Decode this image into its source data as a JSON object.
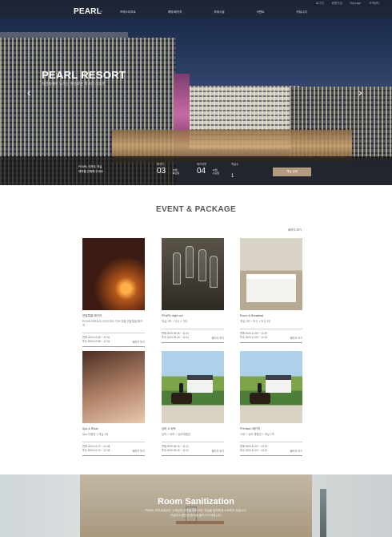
{
  "utility_bar": {
    "links": [
      "로그인",
      "회원가입",
      "My page",
      "고객센터"
    ]
  },
  "nav": {
    "logo": "PEARL",
    "menu": [
      "프레스리조트",
      "예약/패키지",
      "부대시설",
      "이벤트",
      "커뮤니티"
    ]
  },
  "hero": {
    "title": "PEARL RESORT",
    "subtitle": "자연속에서 느끼는 여유로운 럭셔리 리조트",
    "prev_icon": "chevron-left-icon",
    "next_icon": "chevron-right-icon"
  },
  "booking": {
    "message_line1": "PEARL 리조트 객실",
    "message_line2": "예약을 진행해 주세요",
    "checkin": {
      "label": "체크인",
      "day": "03",
      "month": "12월",
      "weekday": "화요일"
    },
    "checkout": {
      "label": "체크아웃",
      "day": "04",
      "month": "12월",
      "weekday": "수요일"
    },
    "guests": {
      "label": "객실수",
      "value": "1"
    },
    "search_button": "객실 검색"
  },
  "events": {
    "title": "EVENT & PACKAGE",
    "more_link": "패키지 보기",
    "cards": [
      {
        "category": "연말특별 패키지",
        "desc": "PEARL리조트의 크리스마스 이브 특별 연말특별 패키지",
        "date1": "판매 2020.12.08 ~ 12.31",
        "date2": "투숙 2020.12.08 ~ 12.31",
        "detail": "패키지 보기",
        "image": "candle-couple"
      },
      {
        "category": "PEARL night out",
        "desc": "객실 1박 + 디너 + 기타",
        "date1": "판매 2020.09.26 ~ 11.01",
        "date2": "투숙 2020.09.26 ~ 11.01",
        "detail": "패키지 보기",
        "image": "wine-glasses"
      },
      {
        "category": "Room & Breakfast",
        "desc": "객실 1박 + 조식 + 조식 2인",
        "date1": "판매 2020.11.09 ~ 11.30",
        "date2": "투숙 2020.11.09 ~ 11.30",
        "detail": "패키지 보기",
        "image": "hotel-bedroom"
      },
      {
        "category": "Spa & Relax",
        "desc": "Spa 이용권 + 객실 1박",
        "date1": "판매 2020.12.13 ~ 12.28",
        "date2": "투숙 2020.12.13 ~ 12.28",
        "detail": "패키지 보기",
        "image": "spa-massage"
      },
      {
        "category": "승마 & 숙박",
        "desc": "승마 + 숙박 + 승마체험권",
        "date1": "판매 2020.09.16 ~ 11.01",
        "date2": "투숙 2020.09.16 ~ 11.01",
        "detail": "패키지 보기",
        "image": "horse-riding"
      },
      {
        "category": "Premium 패키지",
        "desc": "스파 + 승마 체험권 + 객실 1박",
        "date1": "판매 2020.11.03 ~ 12.31",
        "date2": "투숙 2020.11.03 ~ 12.31",
        "detail": "패키지 보기",
        "image": "horse-riding"
      }
    ]
  },
  "banner": {
    "title": "Room Sanitization",
    "line1": "PEARL 리조트에서는 고객님의 안전을 위해 모든 객실을 철저하게 소독하고 있습니다.",
    "line2": "안심하고 편안한 휴식을 즐기시기 바랍니다."
  },
  "colors": {
    "nav_bg": "#1f2638",
    "accent_button": "#b49b7e",
    "title_gray": "#555555"
  }
}
